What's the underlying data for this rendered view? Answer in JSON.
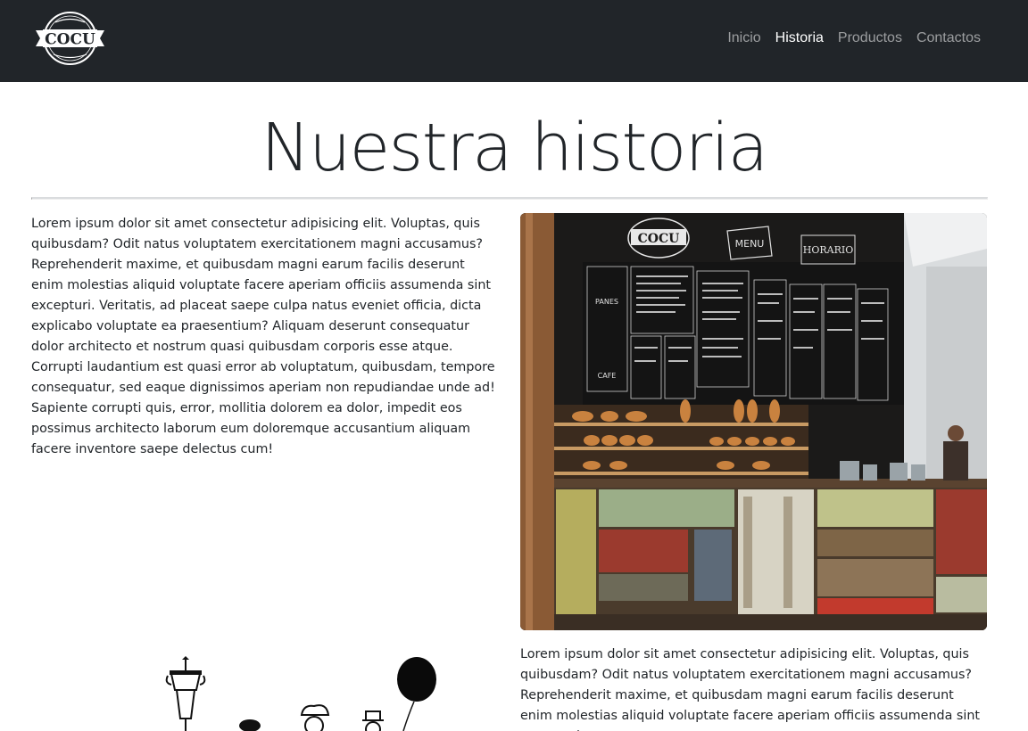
{
  "header": {
    "logo_text": "COCU",
    "nav": [
      {
        "label": "Inicio",
        "active": false
      },
      {
        "label": "Historia",
        "active": true
      },
      {
        "label": "Productos",
        "active": false
      },
      {
        "label": "Contactos",
        "active": false
      }
    ]
  },
  "main": {
    "title": "Nuestra historia",
    "paragraph_1": "Lorem ipsum dolor sit amet consectetur adipisicing elit. Voluptas, quis quibusdam? Odit natus voluptatem exercitationem magni accusamus? Reprehenderit maxime, et quibusdam magni earum facilis deserunt enim molestias aliquid voluptate facere aperiam officiis assumenda sint excepturi. Veritatis, ad placeat saepe culpa natus eveniet officia, dicta explicabo voluptate ea praesentium? Aliquam deserunt consequatur dolor architecto et nostrum quasi quibusdam corporis esse atque. Corrupti laudantium est quasi error ab voluptatum, quibusdam, tempore consequatur, sed eaque dignissimos aperiam non repudiandae unde ad! Sapiente corrupti quis, error, mollitia dolorem ea dolor, impedit eos possimus architecto laborum eum doloremque accusantium aliquam facere inventore saepe delectus cum!",
    "paragraph_2": "Lorem ipsum dolor sit amet consectetur adipisicing elit. Voluptas, quis quibusdam? Odit natus voluptatem exercitationem magni accusamus? Reprehenderit maxime, et quibusdam magni earum facilis deserunt enim molestias aliquid voluptate facere aperiam officiis assumenda sint excepturi.",
    "photo_signs": {
      "menu": "MENU",
      "horario": "HORARIO",
      "panes": "PANES",
      "cafe": "CAFE"
    }
  },
  "colors": {
    "navbar_bg": "#212529",
    "nav_active": "#ffffff",
    "nav_inactive": "rgba(255,255,255,0.55)",
    "text": "#212529",
    "divider": "#dadcde"
  }
}
